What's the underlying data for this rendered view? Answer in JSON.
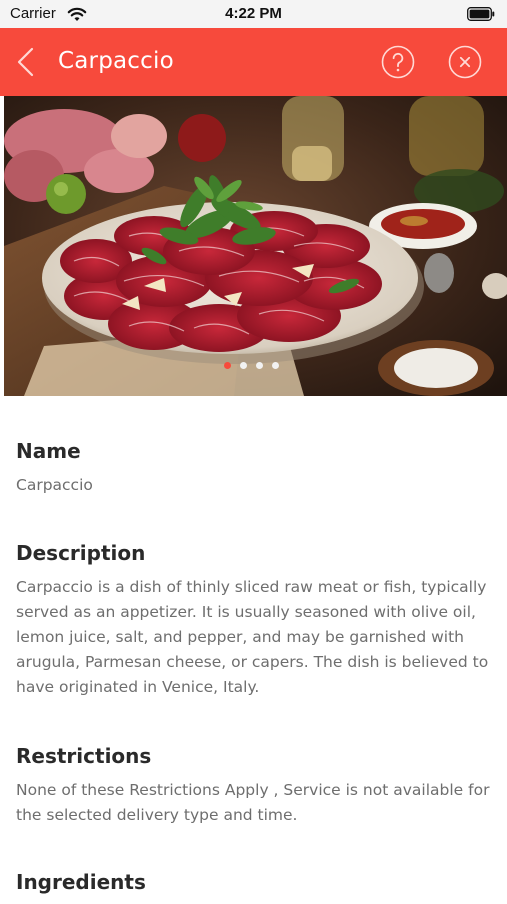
{
  "status_bar": {
    "carrier": "Carrier",
    "time": "4:22 PM",
    "wifi_icon": "wifi-icon",
    "battery_icon": "battery-icon"
  },
  "nav": {
    "title": "Carpaccio",
    "back_icon": "chevron-left-icon",
    "help_icon": "question-circle-icon",
    "close_icon": "close-circle-icon",
    "background_color": "#f74a3c"
  },
  "hero": {
    "image_subject": "plate of carpaccio with arugula and parmesan",
    "carousel": {
      "page_count": 4,
      "active_index": 0
    }
  },
  "sections": {
    "name": {
      "title": "Name",
      "text": "Carpaccio"
    },
    "description": {
      "title": "Description",
      "text": "Carpaccio is a dish of thinly sliced raw meat or fish, typically served as an appetizer. It is usually seasoned with olive oil, lemon juice, salt, and pepper, and may be garnished with arugula, Parmesan cheese, or capers. The dish is believed to have originated in Venice, Italy."
    },
    "restrictions": {
      "title": "Restrictions",
      "text": "None of these Restrictions Apply , Service is not available for the selected delivery type and time."
    },
    "ingredients": {
      "title": "Ingredients"
    }
  }
}
